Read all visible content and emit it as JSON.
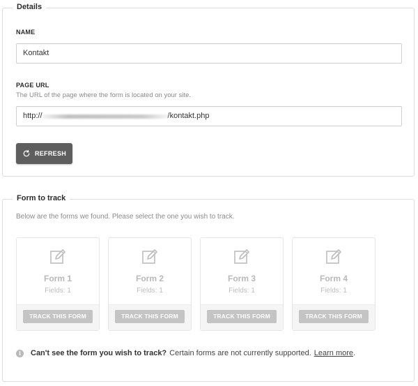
{
  "details": {
    "legend": "Details",
    "name_label": "NAME",
    "name_value": "Kontakt",
    "url_label": "PAGE URL",
    "url_help": "The URL of the page where the form is located on your site.",
    "url_prefix": "http://",
    "url_suffix": "/kontakt.php",
    "refresh_label": "REFRESH"
  },
  "track": {
    "legend": "Form to track",
    "intro": "Below are the forms we found. Please select the one you wish to track.",
    "cards": [
      {
        "name": "Form 1",
        "fields": "Fields: 1",
        "button": "TRACK THIS FORM",
        "icon": "edit-icon"
      },
      {
        "name": "Form 2",
        "fields": "Fields: 1",
        "button": "TRACK THIS FORM",
        "icon": "edit-icon"
      },
      {
        "name": "Form 3",
        "fields": "Fields: 1",
        "button": "TRACK THIS FORM",
        "icon": "edit-icon"
      },
      {
        "name": "Form 4",
        "fields": "Fields: 1",
        "button": "TRACK THIS FORM",
        "icon": "edit-icon"
      }
    ],
    "notice_bold": "Can't see the form you wish to track?",
    "notice_text": "Certain forms are not currently supported.",
    "notice_link": "Learn more",
    "notice_end": "."
  },
  "colors": {
    "button_dark": "#5e5e5e",
    "button_disabled": "#c4c4c4",
    "muted_text": "#8a8a8a"
  }
}
